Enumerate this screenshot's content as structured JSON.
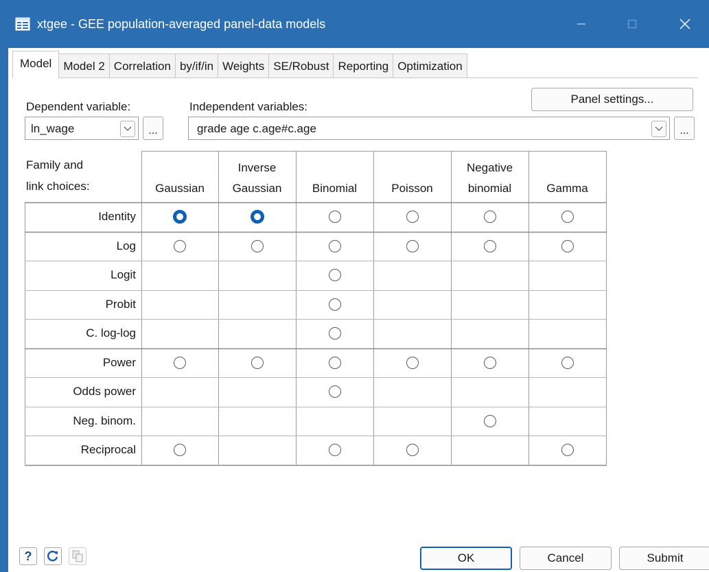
{
  "window": {
    "title": "xtgee - GEE population-averaged panel-data models"
  },
  "tabs": [
    "Model",
    "Model 2",
    "Correlation",
    "by/if/in",
    "Weights",
    "SE/Robust",
    "Reporting",
    "Optimization"
  ],
  "active_tab": "Model",
  "panel_settings_label": "Panel settings...",
  "dependent": {
    "label": "Dependent variable:",
    "value": "ln_wage"
  },
  "independent": {
    "label": "Independent variables:",
    "value": "grade age c.age#c.age"
  },
  "ellipsis": "...",
  "family": {
    "corner_label_1": "Family and",
    "corner_label_2": "link choices:",
    "columns": [
      {
        "line1": "",
        "line2": "Gaussian"
      },
      {
        "line1": "Inverse",
        "line2": "Gaussian"
      },
      {
        "line1": "",
        "line2": "Binomial"
      },
      {
        "line1": "",
        "line2": "Poisson"
      },
      {
        "line1": "Negative",
        "line2": "binomial"
      },
      {
        "line1": "",
        "line2": "Gamma"
      }
    ],
    "rows": [
      {
        "label": "Identity",
        "options": [
          1,
          1,
          1,
          1,
          1,
          1
        ]
      },
      {
        "label": "Log",
        "options": [
          1,
          1,
          1,
          1,
          1,
          1
        ]
      },
      {
        "label": "Logit",
        "options": [
          0,
          0,
          1,
          0,
          0,
          0
        ]
      },
      {
        "label": "Probit",
        "options": [
          0,
          0,
          1,
          0,
          0,
          0
        ]
      },
      {
        "label": "C. log-log",
        "options": [
          0,
          0,
          1,
          0,
          0,
          0
        ]
      },
      {
        "label": "Power",
        "options": [
          1,
          1,
          1,
          1,
          1,
          1
        ]
      },
      {
        "label": "Odds power",
        "options": [
          0,
          0,
          1,
          0,
          0,
          0
        ]
      },
      {
        "label": "Neg. binom.",
        "options": [
          0,
          0,
          0,
          0,
          1,
          0
        ]
      },
      {
        "label": "Reciprocal",
        "options": [
          1,
          0,
          1,
          1,
          0,
          1
        ]
      }
    ],
    "selected": {
      "row": "Identity",
      "column": "Gaussian"
    }
  },
  "footer": {
    "help_icon": "?",
    "ok_label": "OK",
    "cancel_label": "Cancel",
    "submit_label": "Submit"
  },
  "colors": {
    "titlebar": "#2b6fb2",
    "radio_selected": "#0f5fb4",
    "ok_border": "#0f5fb4"
  }
}
